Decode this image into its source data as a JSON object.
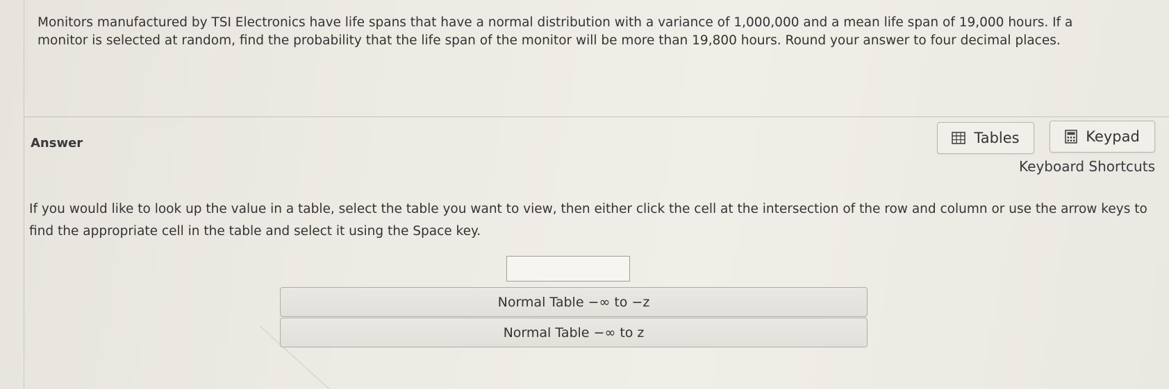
{
  "question": {
    "text": "Monitors manufactured by TSI Electronics have life spans that have a normal distribution with a variance of 1,000,000 and a mean life span of 19,000 hours.  If a monitor is selected at random, find the probability that the life span of the monitor will be more than 19,800 hours. Round your answer to four decimal places."
  },
  "answer": {
    "label": "Answer",
    "value": ""
  },
  "toolbar": {
    "tables_label": "Tables",
    "tables_icon": "table-grid-icon",
    "keypad_label": "Keypad",
    "keypad_icon": "calculator-icon",
    "shortcuts_label": "Keyboard Shortcuts"
  },
  "instructions": {
    "text": "If you would like to look up the value in a table, select the table you want to view, then either click the cell at the intersection of the row and column or use the arrow keys to find the appropriate cell in the table and select it using the Space key."
  },
  "table_options": [
    {
      "label": "Normal Table −∞ to −z"
    },
    {
      "label": "Normal Table −∞ to z"
    }
  ]
}
